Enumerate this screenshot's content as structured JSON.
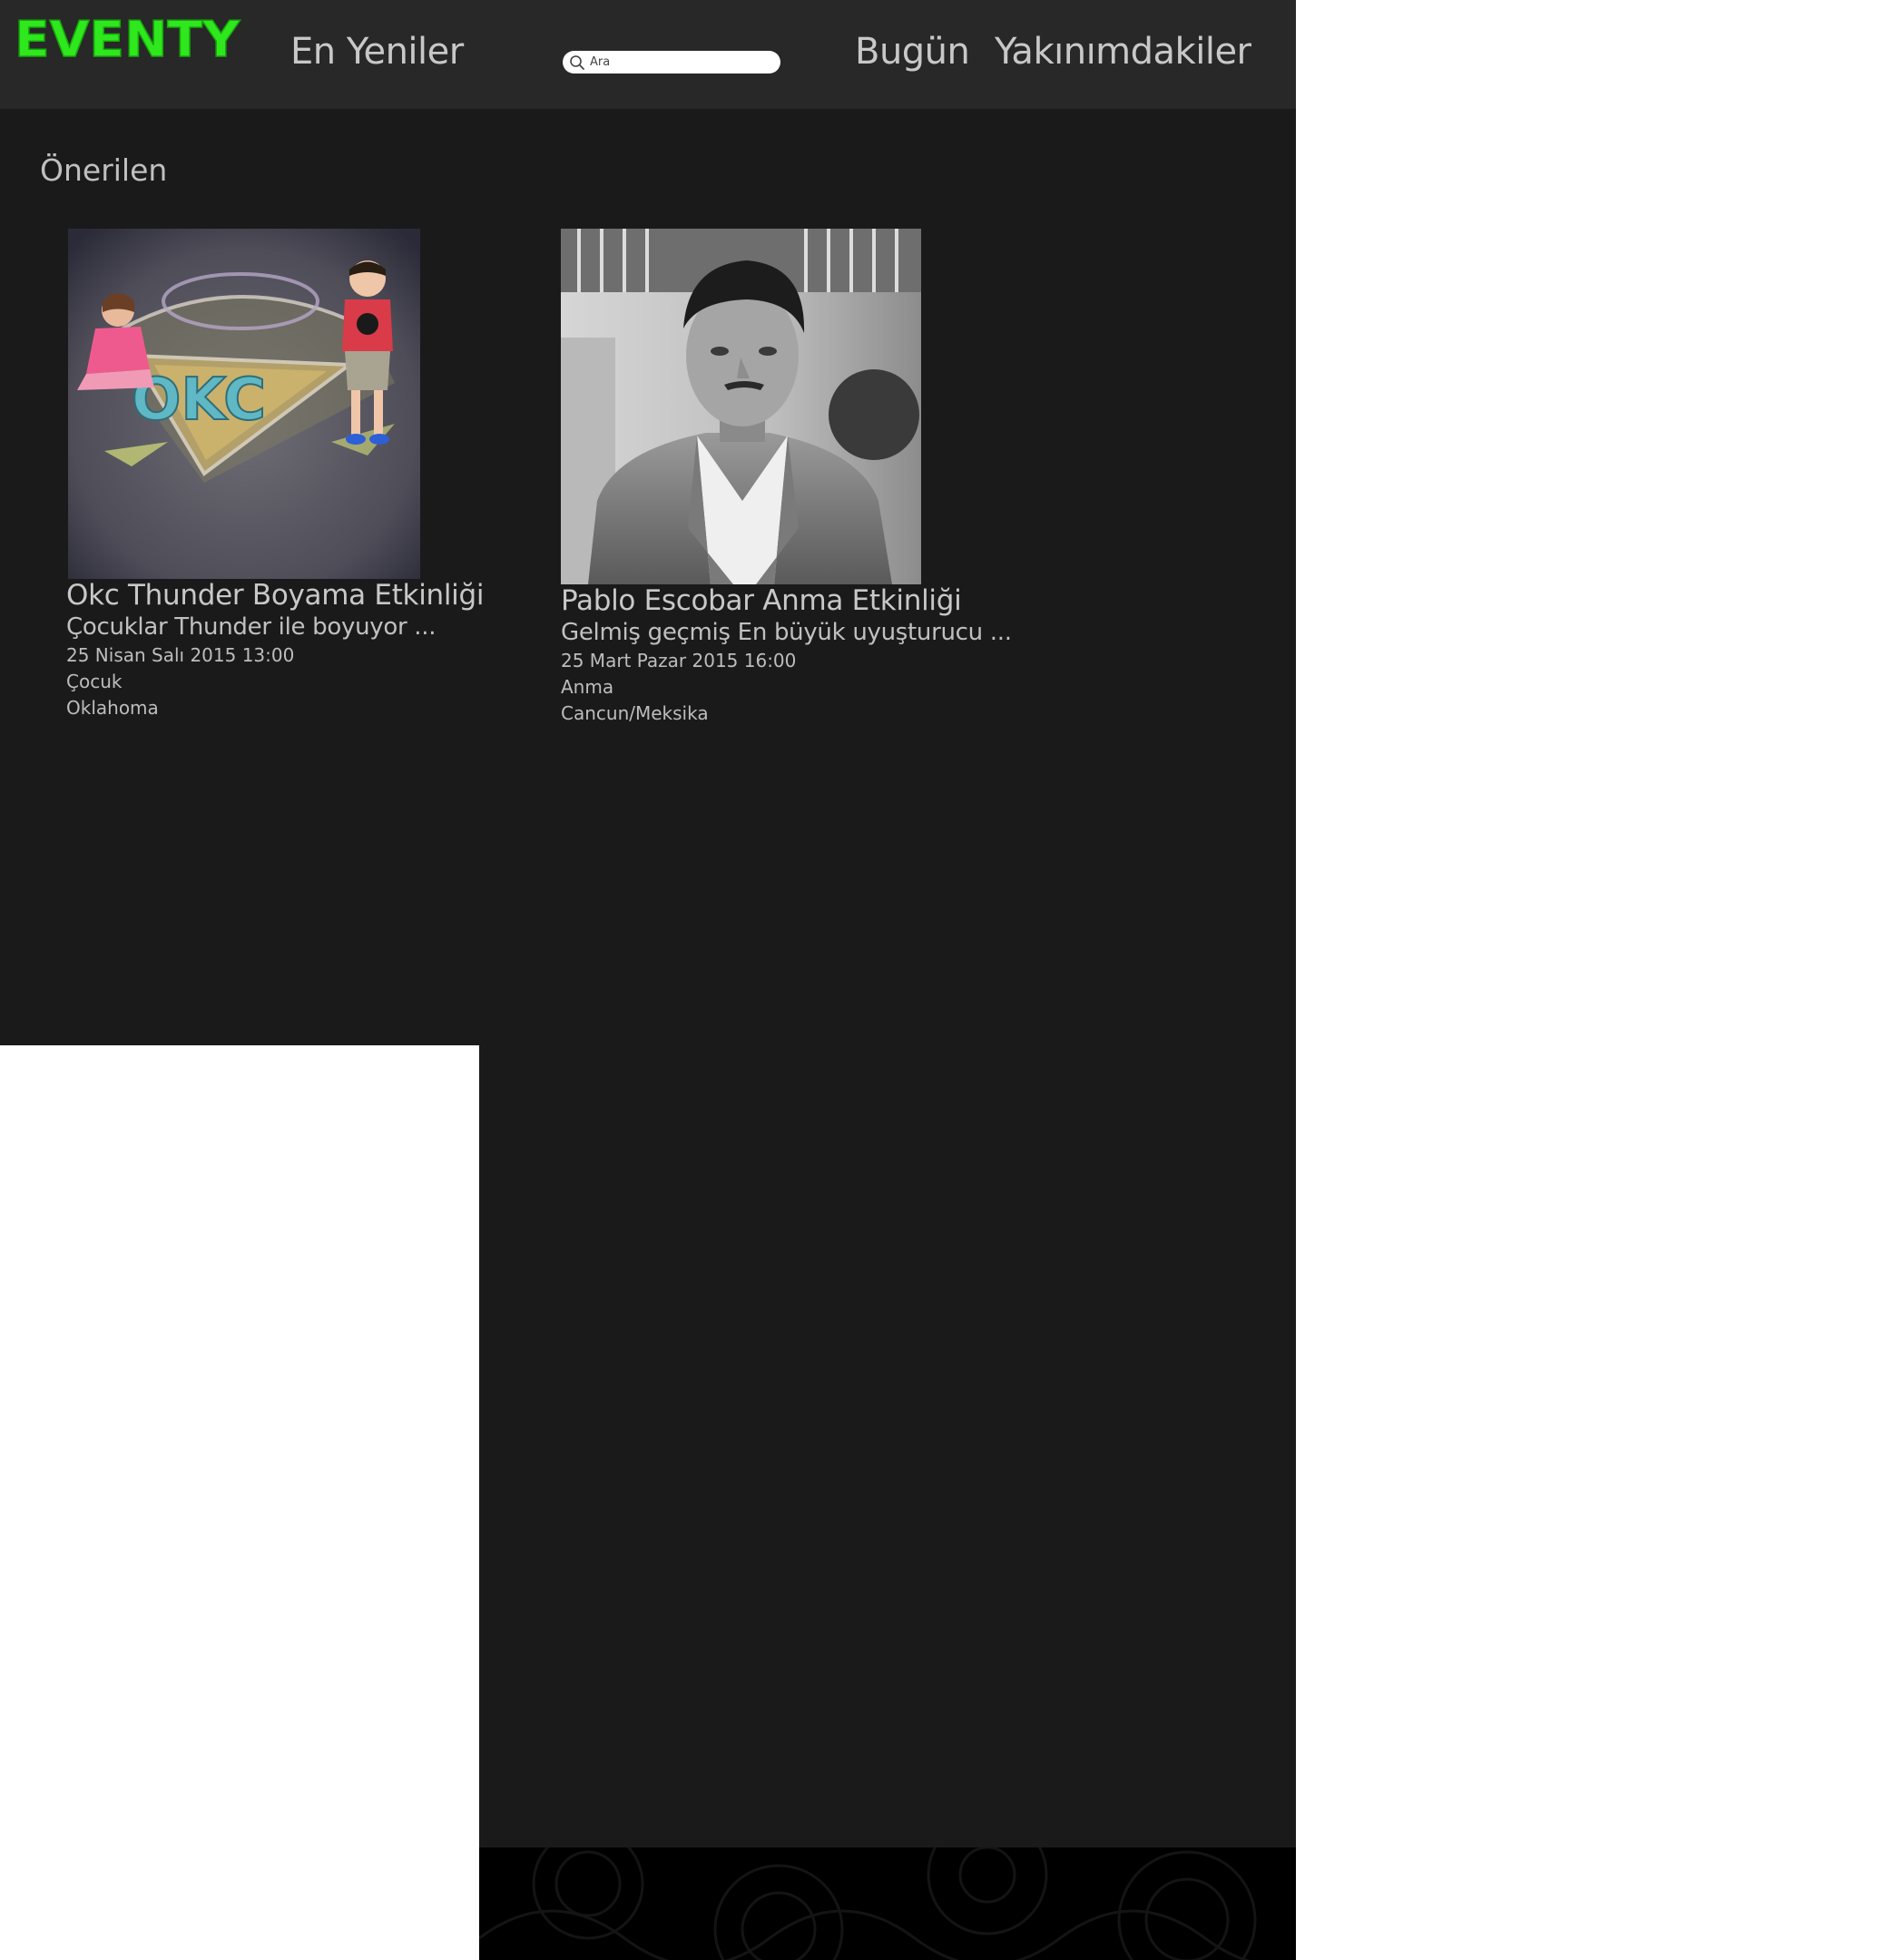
{
  "header": {
    "logo_text": "EVENTY",
    "logo_color": "#2ee81d",
    "nav_newest": "En Yeniler",
    "search_placeholder": "Ara",
    "nav_today": "Bugün",
    "nav_nearby": "Yakınımdakiler"
  },
  "section": {
    "title": "Önerilen"
  },
  "events": [
    {
      "title": "Okc Thunder Boyama Etkinliği",
      "description": "Çocuklar Thunder ile boyuyor ...",
      "datetime": "25 Nisan Salı 2015 13:00",
      "category": "Çocuk",
      "location": "Oklahoma",
      "image": "okc-chalk-drawing-photo",
      "image_text": "OKC"
    },
    {
      "title": "Pablo Escobar Anma Etkinliği",
      "description": "Gelmiş geçmiş En büyük uyuşturucu ...",
      "datetime": "25 Mart Pazar 2015 16:00",
      "category": "Anma",
      "location": "Cancun/Meksika",
      "image": "black-white-portrait-photo"
    }
  ]
}
